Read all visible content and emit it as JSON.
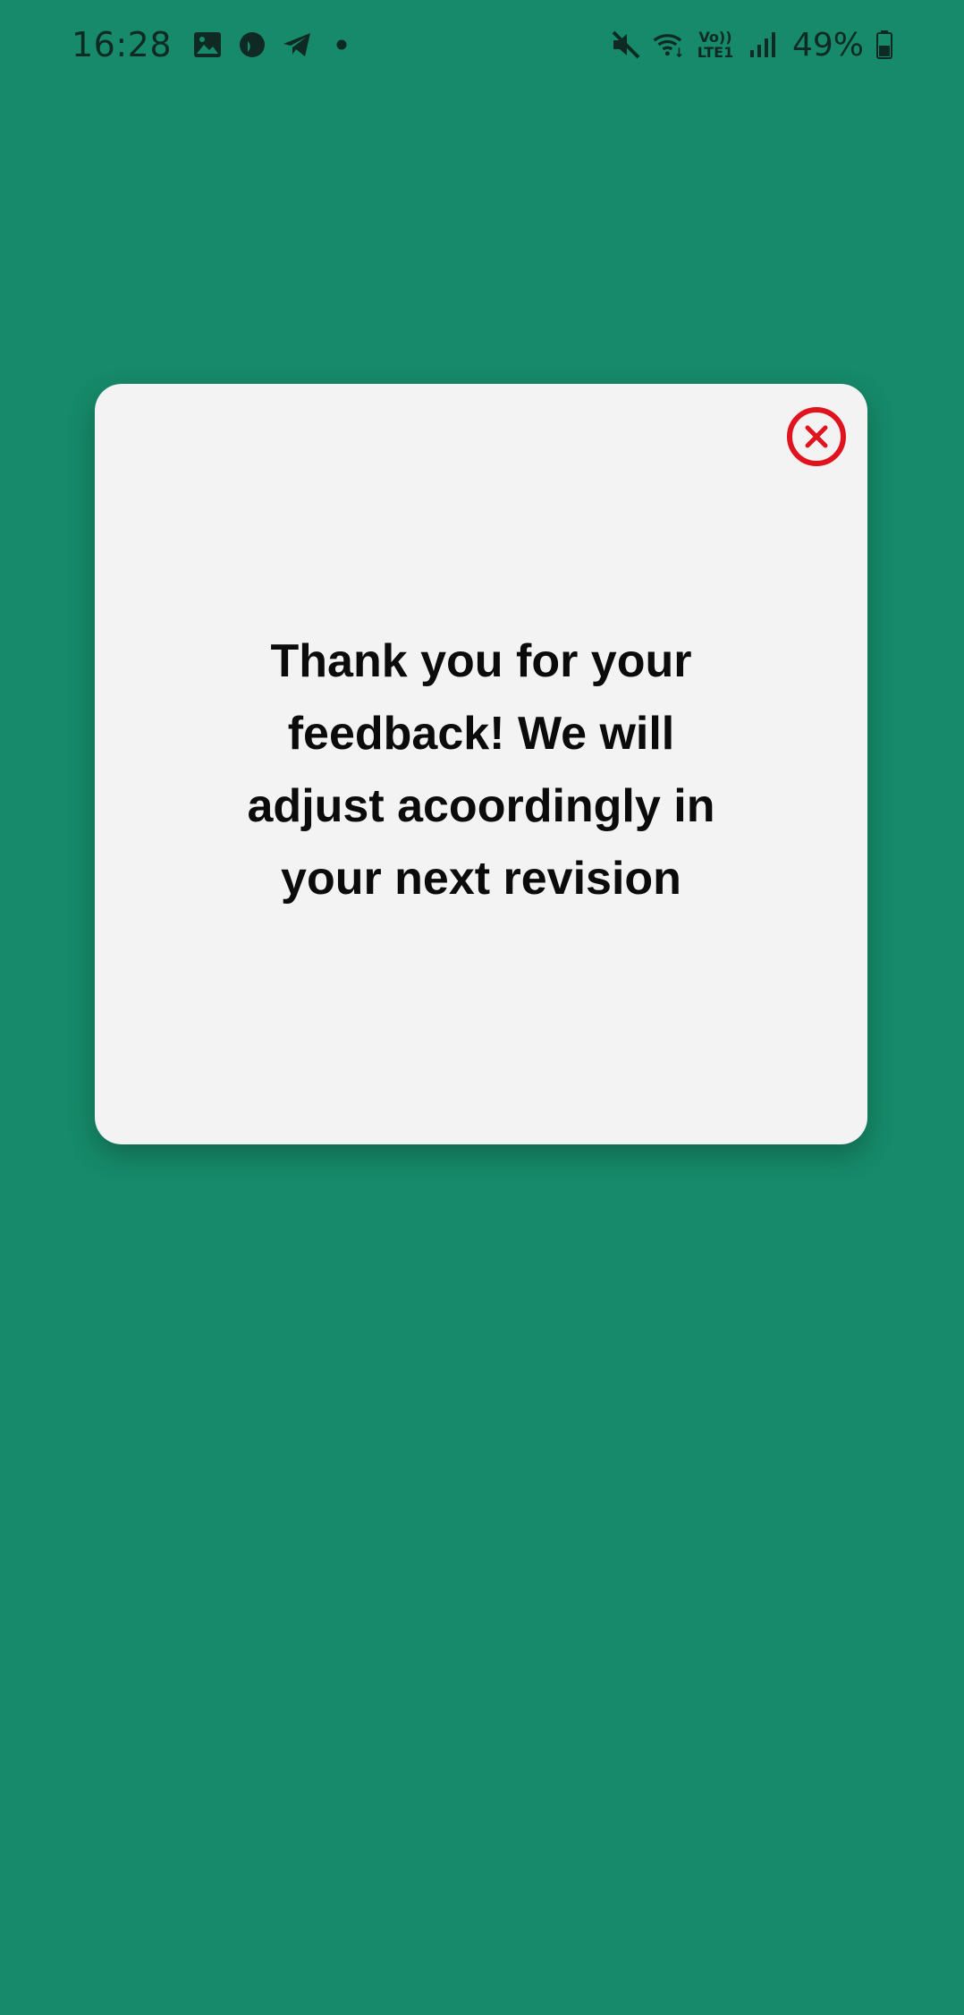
{
  "status_bar": {
    "time": "16:28",
    "battery_percent": "49%",
    "left_icons": [
      "gallery-icon",
      "app-notification-icon",
      "telegram-icon",
      "notification-dot-icon"
    ],
    "right_icons": [
      "mute-icon",
      "wifi-icon",
      "volte-lte-icon",
      "signal-icon",
      "battery-icon"
    ],
    "volte_label_top": "Vo))",
    "volte_label_bottom": "LTE1",
    "battery_level": 0.49
  },
  "dialog": {
    "message": "Thank you for your feedback! We will adjust acoordingly in your next revision",
    "close_icon": "close-icon"
  },
  "colors": {
    "background": "#168a6a",
    "dialog_background": "#f3f3f3",
    "close_accent": "#e0141e",
    "text": "#0b0b0b"
  }
}
